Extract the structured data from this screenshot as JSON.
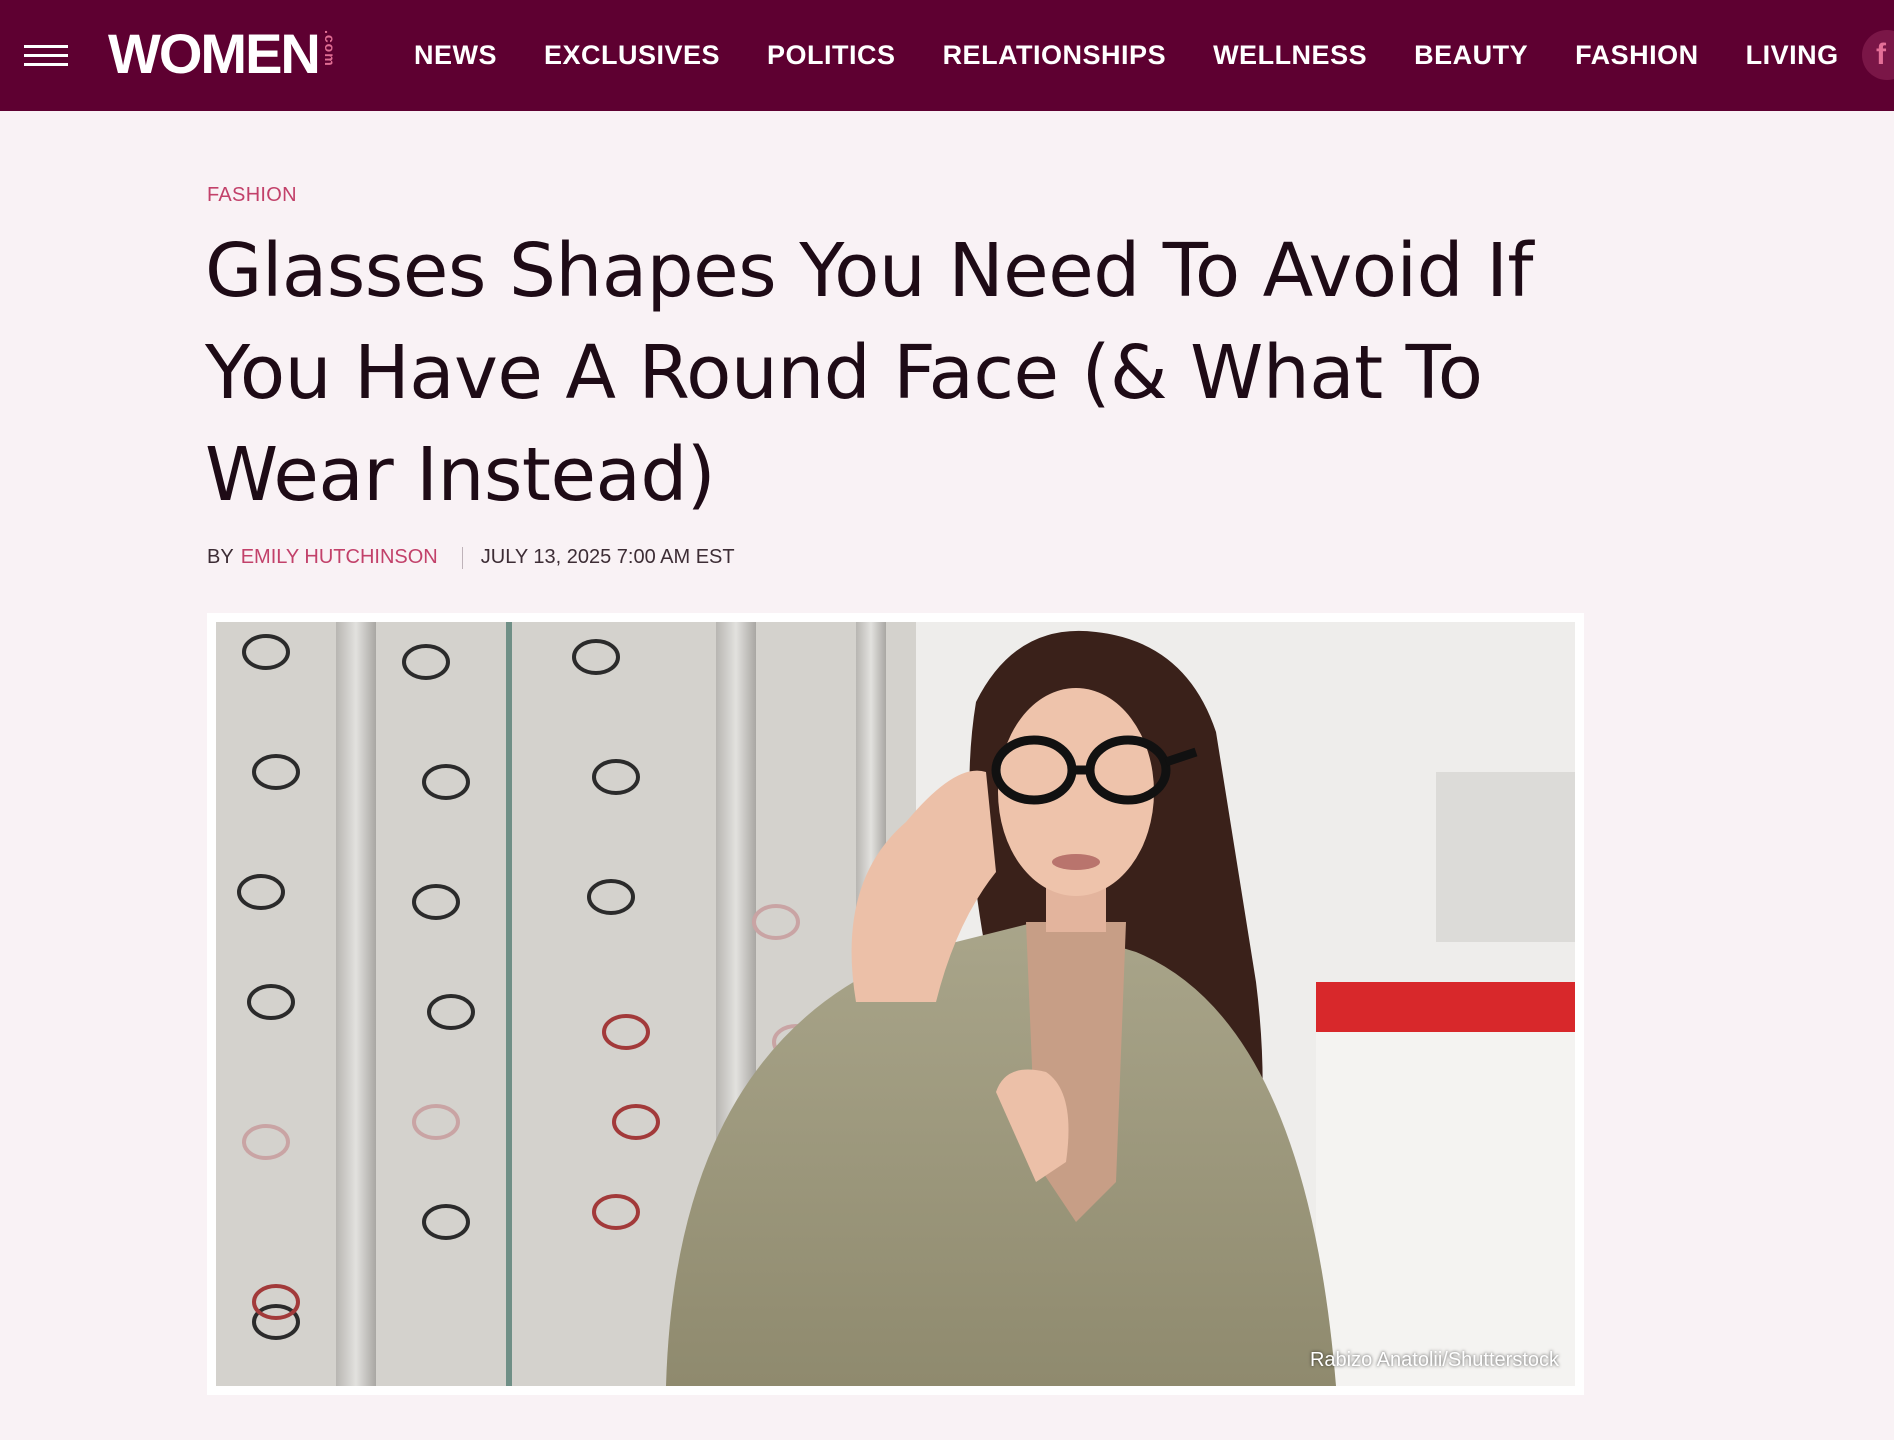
{
  "header": {
    "logo_text": "WOMEN",
    "logo_suffix": ".com",
    "nav": [
      "NEWS",
      "EXCLUSIVES",
      "POLITICS",
      "RELATIONSHIPS",
      "WELLNESS",
      "BEAUTY",
      "FASHION",
      "LIVING"
    ],
    "social_glyph": "f",
    "colors": {
      "bar": "#5e0031",
      "accent": "#e06d93"
    }
  },
  "article": {
    "category": "FASHION",
    "title": "Glasses Shapes You Need To Avoid If You Have A Round Face (& What To Wear Instead)",
    "by_label": "BY",
    "author": "EMILY HUTCHINSON",
    "date": "JULY 13, 2025 7:00 AM EST",
    "image_credit": "Rabizo Anatolii/Shutterstock",
    "colors": {
      "link": "#c2416a",
      "title": "#1e0b16"
    }
  },
  "icons": [
    "hamburger-menu-icon",
    "facebook-icon"
  ]
}
